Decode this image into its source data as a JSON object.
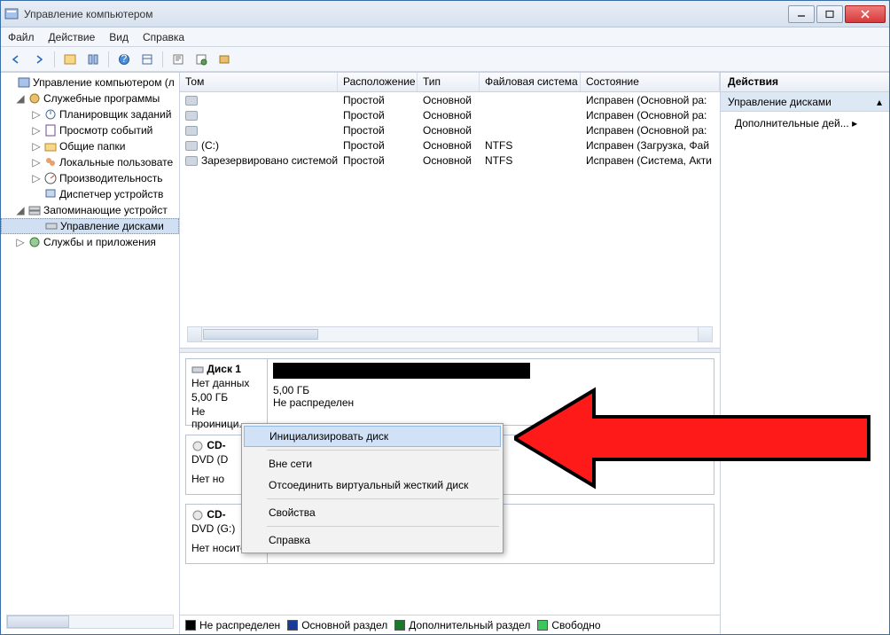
{
  "window": {
    "title": "Управление компьютером"
  },
  "menu": {
    "file": "Файл",
    "action": "Действие",
    "view": "Вид",
    "help": "Справка"
  },
  "tree": {
    "root": "Управление компьютером (л",
    "tools": "Служебные программы",
    "tools_items": {
      "sched": "Планировщик заданий",
      "events": "Просмотр событий",
      "shared": "Общие папки",
      "users": "Локальные пользовате",
      "perf": "Производительность",
      "devmgr": "Диспетчер устройств"
    },
    "storage": "Запоминающие устройст",
    "diskmgmt": "Управление дисками",
    "services": "Службы и приложения"
  },
  "vol_cols": {
    "tom": "Том",
    "layout": "Расположение",
    "type": "Тип",
    "fs": "Файловая система",
    "state": "Состояние"
  },
  "vol_col_w": {
    "tom": 178,
    "layout": 90,
    "type": 70,
    "fs": 114,
    "state": 148
  },
  "volumes": [
    {
      "name": "",
      "layout": "Простой",
      "type": "Основной",
      "fs": "",
      "state": "Исправен (Основной ра:"
    },
    {
      "name": "",
      "layout": "Простой",
      "type": "Основной",
      "fs": "",
      "state": "Исправен (Основной ра:"
    },
    {
      "name": "",
      "layout": "Простой",
      "type": "Основной",
      "fs": "",
      "state": "Исправен (Основной ра:"
    },
    {
      "name": "(C:)",
      "layout": "Простой",
      "type": "Основной",
      "fs": "NTFS",
      "state": "Исправен (Загрузка, Фай"
    },
    {
      "name": "Зарезервировано системой",
      "layout": "Простой",
      "type": "Основной",
      "fs": "NTFS",
      "state": "Исправен (Система, Акти"
    }
  ],
  "disk1": {
    "name": "Диск 1",
    "line1": "Нет данных",
    "line2": "5,00 ГБ",
    "line3": "Не проиници...",
    "part_size": "5,00 ГБ",
    "part_state": "Не распределен"
  },
  "cd0": {
    "name": "CD-",
    "drive": "DVD (D",
    "state": "Нет но"
  },
  "cd1": {
    "name": "CD-",
    "drive": "DVD (G:)",
    "state": "Нет носителя"
  },
  "legend": {
    "unalloc": "Не распределен",
    "primary": "Основной раздел",
    "extra": "Дополнительный раздел",
    "free": "Свободно"
  },
  "actions": {
    "header": "Действия",
    "section": "Управление дисками",
    "more": "Дополнительные дей..."
  },
  "context": {
    "init": "Инициализировать диск",
    "offline": "Вне сети",
    "detach": "Отсоединить виртуальный жесткий диск",
    "props": "Свойства",
    "help": "Справка"
  }
}
